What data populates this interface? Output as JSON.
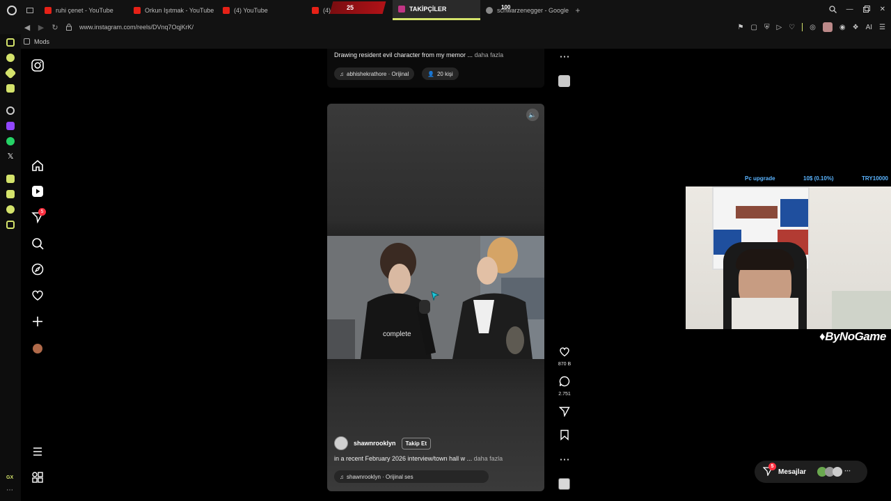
{
  "tabs": [
    {
      "label": "ruhi çenet - YouTube"
    },
    {
      "label": "Orkun Işıtmak - YouTube"
    },
    {
      "label": "(4) YouTube"
    },
    {
      "label": "(4) In"
    },
    {
      "label": "TAKİPÇİLER"
    },
    {
      "label": "schwarzenegger - Google"
    }
  ],
  "tab_overlay": {
    "count_left": "25",
    "count_right": "100"
  },
  "url": "www.instagram.com/reels/DVnq7OqjKrK/",
  "bookmarks": {
    "mods": "Mods"
  },
  "toolbar": {
    "ai_label": "AI"
  },
  "opera_side": {
    "gx_label": "GX"
  },
  "ig_nav": {
    "notification_badge": "5"
  },
  "top_post": {
    "caption": "Drawing resident evil character from my memor ...",
    "more": "daha fazla",
    "audio": "abhishekrathore · Orijinal",
    "people": "20 kişi"
  },
  "reel": {
    "username": "shawnrooklyn",
    "follow": "Takip Et",
    "caption": "in a recent February 2026 interview/town hall w ...",
    "more": "daha fazla",
    "audio": "shawnrooklyn · Orijinal ses",
    "shirt_text": "complete"
  },
  "actions": {
    "likes": "870 B",
    "comments": "2.751"
  },
  "stream_overlay": {
    "left": "Pc upgrade",
    "mid": "10$ (0.10%)",
    "right": "TRY10000"
  },
  "brand": "ByNoGame",
  "messages": {
    "label": "Mesajlar",
    "badge": "5"
  }
}
